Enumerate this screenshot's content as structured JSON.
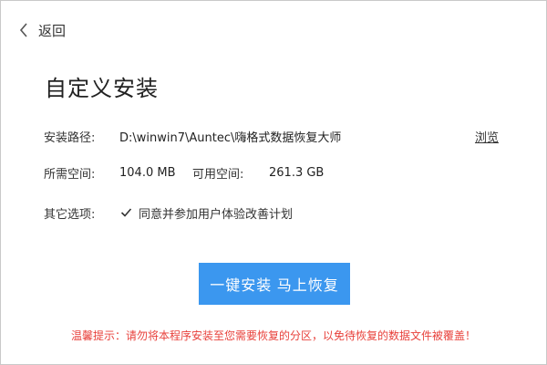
{
  "back": {
    "label": "返回",
    "icon": "chevron-left-icon"
  },
  "title": "自定义安装",
  "install_path": {
    "label": "安装路径:",
    "value": "D:\\winwin7\\Auntec\\嗨格式数据恢复大师",
    "browse_label": "浏览"
  },
  "space": {
    "required_label": "所需空间:",
    "required_value": "104.0 MB",
    "available_label": "可用空间:",
    "available_value": "261.3 GB"
  },
  "options": {
    "label": "其它选项:",
    "checkbox_checked": true,
    "checkbox_text": "同意并参加用户体验改善计划"
  },
  "install_button": {
    "label": "一键安装  马上恢复",
    "color": "#3b97ef"
  },
  "warning": {
    "text": "温馨提示：请勿将本程序安装至您需要恢复的分区，以免待恢复的数据文件被覆盖！",
    "color": "#e8413b"
  }
}
